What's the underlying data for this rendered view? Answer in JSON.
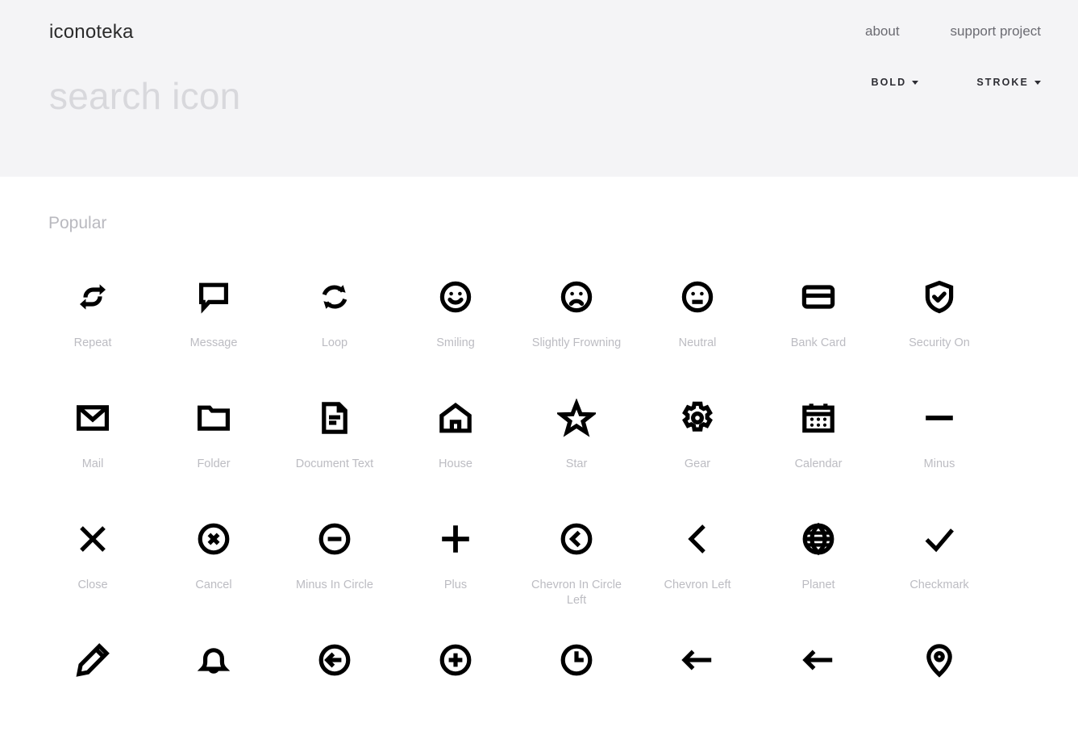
{
  "header": {
    "brand": "iconoteka",
    "nav": [
      {
        "label": "about",
        "name": "nav-about"
      },
      {
        "label": "support project",
        "name": "nav-support-project"
      }
    ],
    "search": {
      "value": "",
      "placeholder": "search icon"
    },
    "selectors": [
      {
        "label": "BOLD",
        "name": "weight-selector"
      },
      {
        "label": "STROKE",
        "name": "style-selector"
      }
    ],
    "background_color": "#f4f4f6"
  },
  "main": {
    "section_title": "Popular",
    "label_color": "#bcbcc2",
    "icon_color": "#000000",
    "icons": [
      {
        "label": "Repeat",
        "icon": "repeat-icon"
      },
      {
        "label": "Message",
        "icon": "message-icon"
      },
      {
        "label": "Loop",
        "icon": "loop-icon"
      },
      {
        "label": "Smiling",
        "icon": "smiling-face-icon"
      },
      {
        "label": "Slightly Frowning",
        "icon": "slightly-frowning-face-icon"
      },
      {
        "label": "Neutral",
        "icon": "neutral-face-icon"
      },
      {
        "label": "Bank Card",
        "icon": "bank-card-icon"
      },
      {
        "label": "Security On",
        "icon": "shield-check-icon"
      },
      {
        "label": "Mail",
        "icon": "mail-icon"
      },
      {
        "label": "Folder",
        "icon": "folder-icon"
      },
      {
        "label": "Document Text",
        "icon": "document-text-icon"
      },
      {
        "label": "House",
        "icon": "house-icon"
      },
      {
        "label": "Star",
        "icon": "star-icon"
      },
      {
        "label": "Gear",
        "icon": "gear-icon"
      },
      {
        "label": "Calendar",
        "icon": "calendar-icon"
      },
      {
        "label": "Minus",
        "icon": "minus-icon"
      },
      {
        "label": "Close",
        "icon": "close-icon"
      },
      {
        "label": "Cancel",
        "icon": "cancel-circle-icon"
      },
      {
        "label": "Minus In Circle",
        "icon": "minus-in-circle-icon"
      },
      {
        "label": "Plus",
        "icon": "plus-icon"
      },
      {
        "label": "Chevron In Circle Left",
        "icon": "chevron-in-circle-left-icon"
      },
      {
        "label": "Chevron Left",
        "icon": "chevron-left-icon"
      },
      {
        "label": "Planet",
        "icon": "planet-icon"
      },
      {
        "label": "Checkmark",
        "icon": "checkmark-icon"
      },
      {
        "label": "",
        "icon": "pencil-icon"
      },
      {
        "label": "",
        "icon": "bell-icon"
      },
      {
        "label": "",
        "icon": "arrow-left-in-circle-icon"
      },
      {
        "label": "",
        "icon": "plus-in-circle-icon"
      },
      {
        "label": "",
        "icon": "clock-icon"
      },
      {
        "label": "",
        "icon": "arrow-left-icon"
      },
      {
        "label": "",
        "icon": "arrow-left-long-icon"
      },
      {
        "label": "",
        "icon": "map-pin-icon"
      }
    ]
  }
}
